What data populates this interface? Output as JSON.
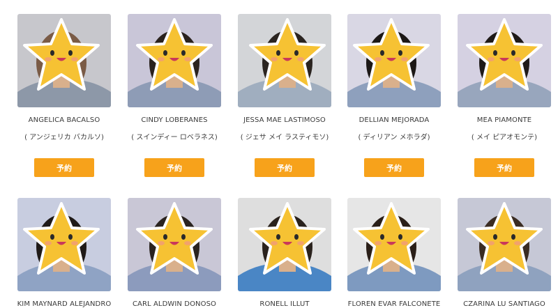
{
  "reserve_label": "予約",
  "row1": [
    {
      "name": "ANGELICA BACALSO",
      "kana": "( アンジェリカ バカルソ)",
      "bg": "#c7c7cc",
      "shirt": "#8d98a8",
      "hair": "#7a5b46"
    },
    {
      "name": "CINDY LOBERANES",
      "kana": "( スインディー ロベラネス)",
      "bg": "#c9c6d8",
      "shirt": "#8e9cb6",
      "hair": "#2a221e"
    },
    {
      "name": "JESSA MAE LASTIMOSO",
      "kana": "( ジェサ メイ ラスティモソ)",
      "bg": "#d3d5d8",
      "shirt": "#a0aebf",
      "hair": "#2a2420"
    },
    {
      "name": "DELLIAN MEJORADA",
      "kana": "( ディリアン メホラダ)",
      "bg": "#d9d7e4",
      "shirt": "#8ea0bd",
      "hair": "#1c1816"
    },
    {
      "name": "MEA PIAMONTE",
      "kana": "( メイ ピアオモンテ)",
      "bg": "#d5d1e2",
      "shirt": "#98a6bd",
      "hair": "#1f1a18"
    }
  ],
  "row2": [
    {
      "name": "KIM MAYNARD ALEJANDRO",
      "bg": "#c8cde0",
      "shirt": "#8fa3c4",
      "hair": "#1f1a18"
    },
    {
      "name": "CARL ALDWIN DONOSO",
      "bg": "#c9c7d6",
      "shirt": "#8c9bbd",
      "hair": "#2a231f"
    },
    {
      "name": "RONELL ILLUT",
      "bg": "#dedede",
      "shirt": "#4a86c5",
      "hair": "#2a221d"
    },
    {
      "name": "FLOREN EVAR FALCONETE",
      "bg": "#e6e6e6",
      "shirt": "#7e9ac0",
      "hair": "#2a1f18"
    },
    {
      "name": "CZARINA LU SANTIAGO",
      "bg": "#c6c8d6",
      "shirt": "#8fa2bf",
      "hair": "#3a2c22"
    }
  ]
}
